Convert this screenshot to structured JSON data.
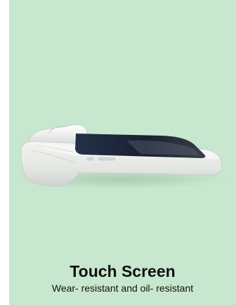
{
  "colors": {
    "background": "#c7e7cf",
    "device_body": "#ecedeb",
    "screen": "#1b2233"
  },
  "product_image": {
    "icon": "pos-terminal-image"
  },
  "caption": {
    "title": "Touch Screen",
    "subtitle": "Wear- resistant and oil- resistant"
  }
}
